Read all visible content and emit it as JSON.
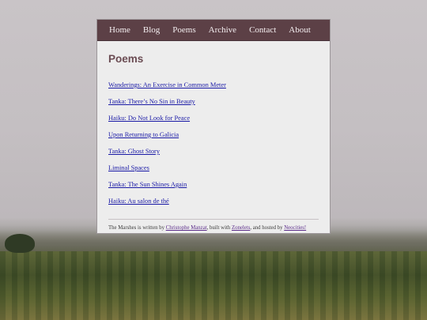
{
  "nav": {
    "items": [
      {
        "label": "Home"
      },
      {
        "label": "Blog"
      },
      {
        "label": "Poems"
      },
      {
        "label": "Archive"
      },
      {
        "label": "Contact"
      },
      {
        "label": "About"
      }
    ]
  },
  "page": {
    "title": "Poems"
  },
  "poems": [
    {
      "title": "Wanderings: An Exercise in Common Meter"
    },
    {
      "title": "Tanka: There’s No Sin in Beauty"
    },
    {
      "title": "Haiku: Do Not Look for Peace"
    },
    {
      "title": "Upon Returning to Galicia"
    },
    {
      "title": "Tanka: Ghost Story"
    },
    {
      "title": "Liminal Spaces"
    },
    {
      "title": "Tanka: The Sun Shines Again"
    },
    {
      "title": "Haiku: Au salon de thé"
    }
  ],
  "footer": {
    "prefix": "The Marshes is written by ",
    "author": "Christophe Manzat",
    "built_with_text": ", built with ",
    "builder": "Zonelets",
    "hosted_text": ", and hosted by ",
    "host": "Neocities!"
  },
  "colors": {
    "nav_bg": "#5c4046",
    "panel_bg": "#ededed",
    "title": "#6a4b52",
    "link": "#1a1aa6"
  }
}
